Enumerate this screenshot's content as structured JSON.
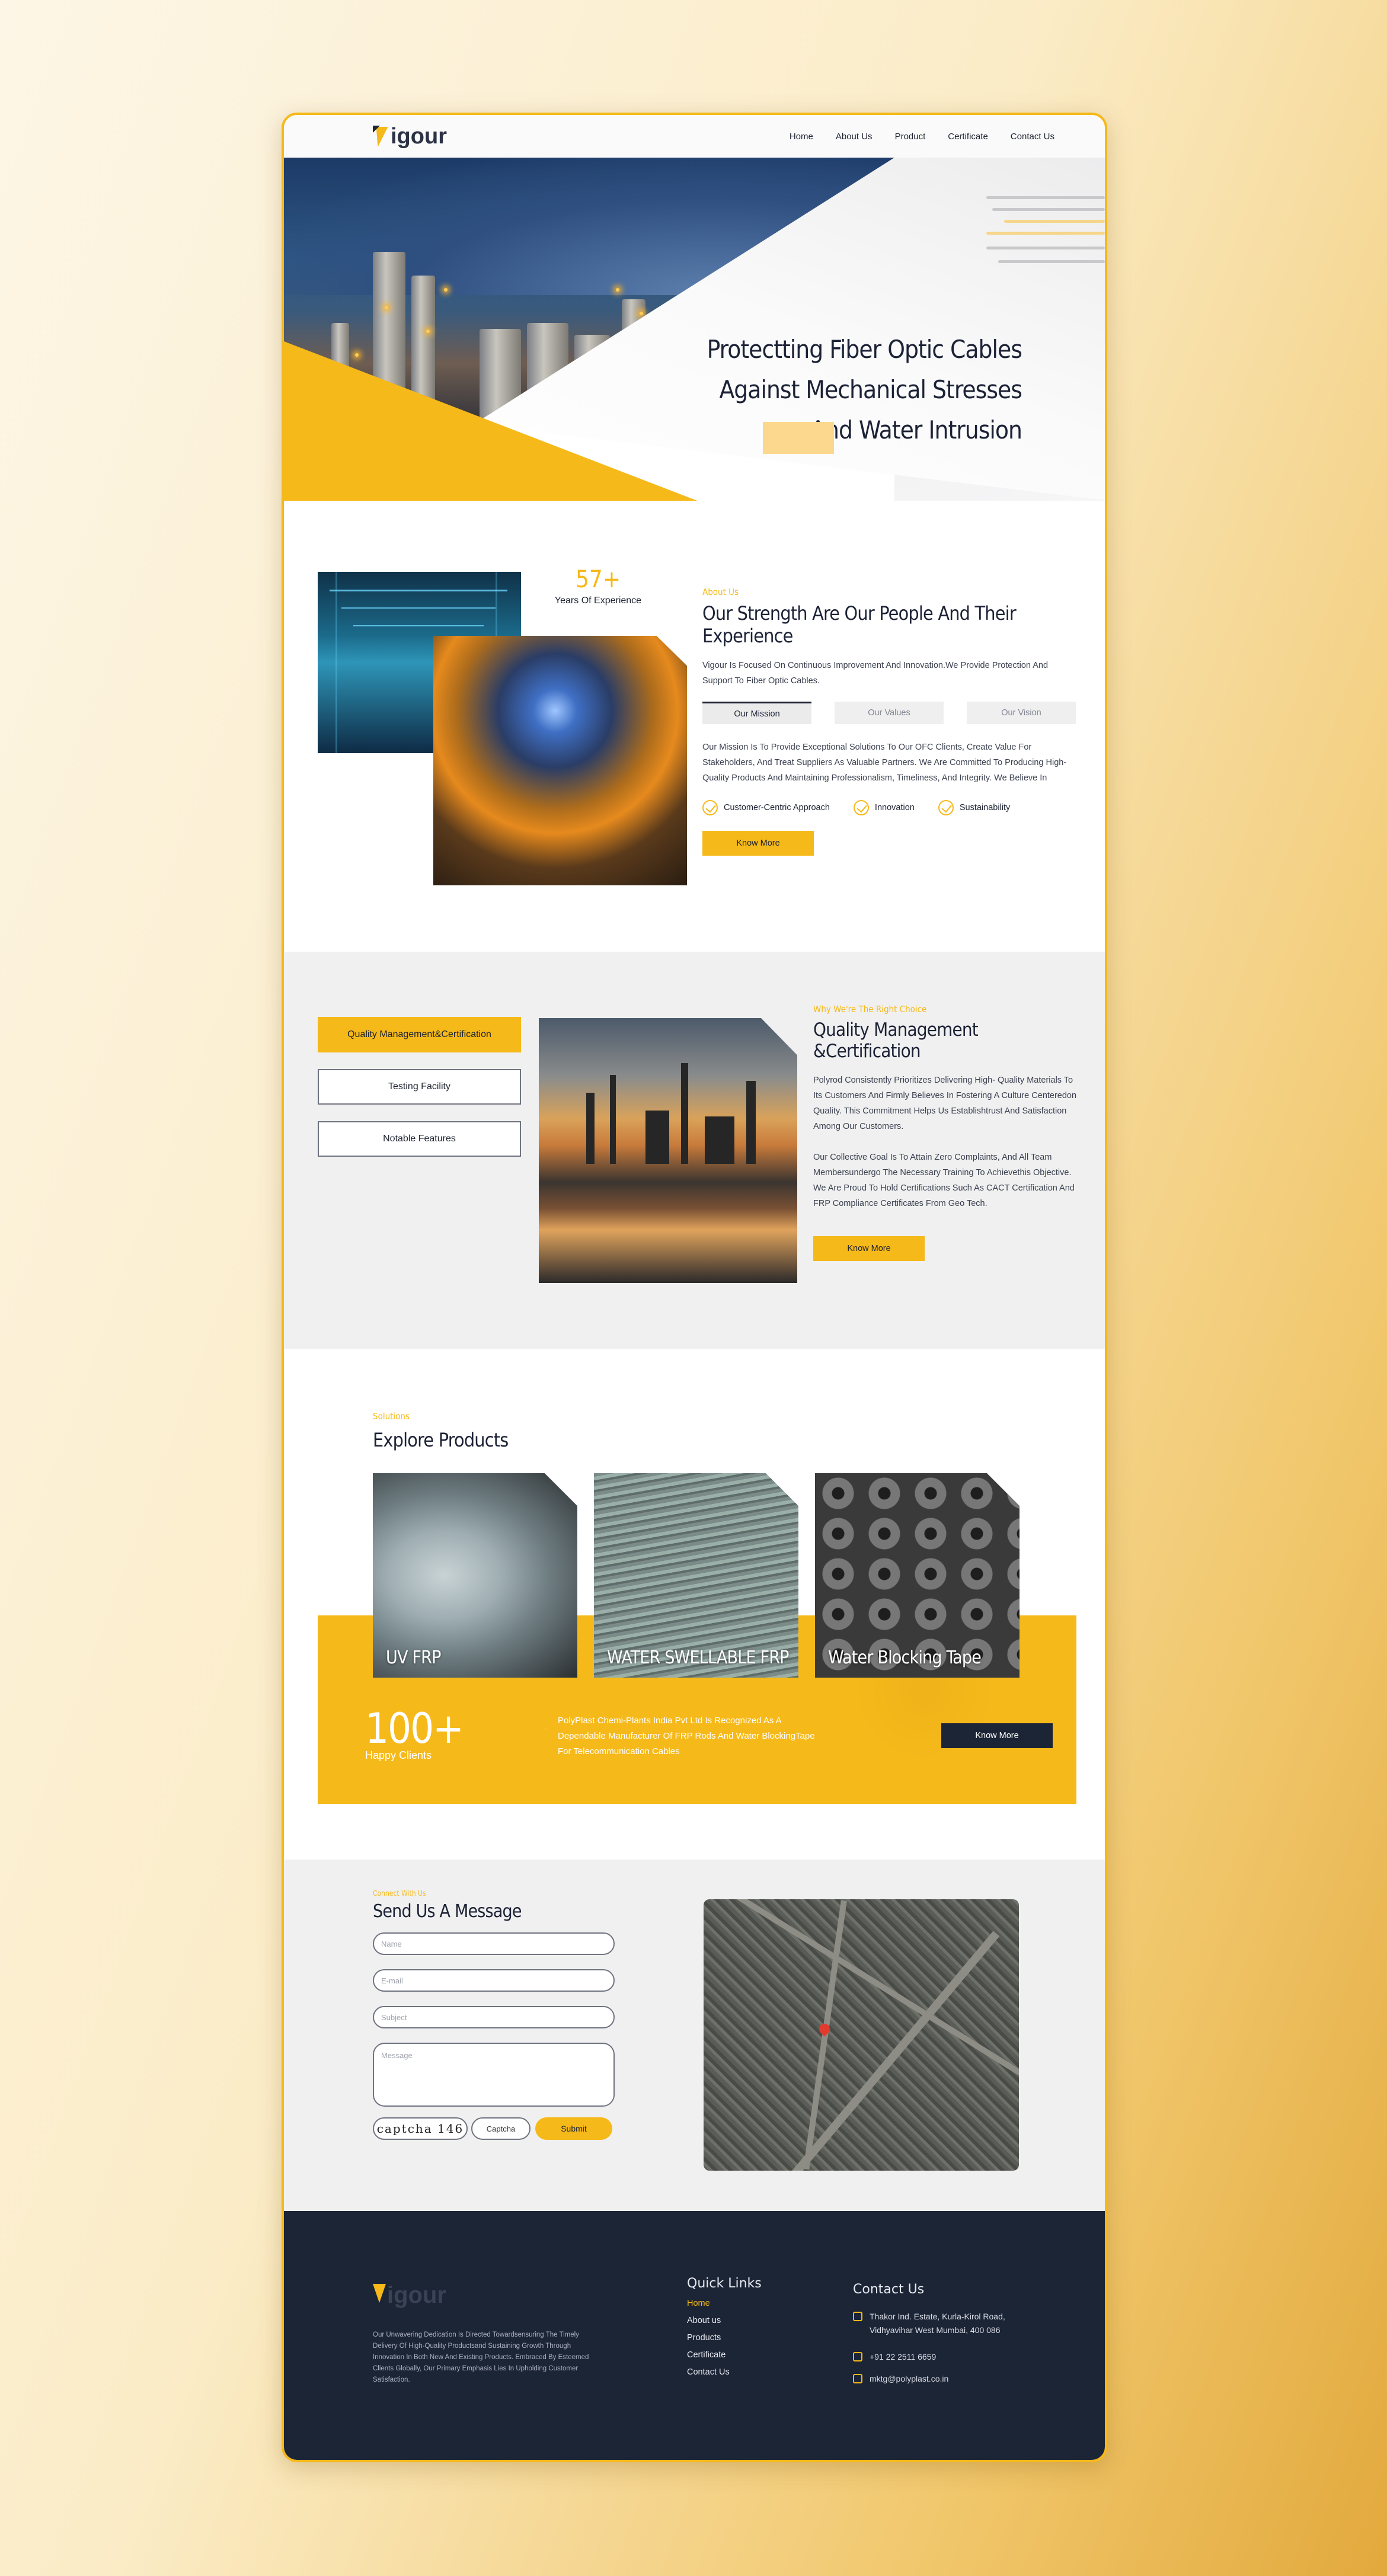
{
  "brand": {
    "name": "igour",
    "accent": "#f6b91a",
    "navy": "#1c2536"
  },
  "nav": [
    "Home",
    "About Us",
    "Product",
    "Certificate",
    "Contact  Us"
  ],
  "hero": {
    "line1": "Protectting Fiber Optic Cables",
    "line2": "Against  Mechanical Stresses",
    "line3": "And Water Intrusion"
  },
  "about": {
    "exp_number": "57+",
    "exp_label": "Years Of Experience",
    "tag": "About Us",
    "title": "Our Strength Are Our People And Their Experience",
    "text": "Vigour Is Focused On Continuous Improvement And Innovation.We Provide Protection And Support To Fiber Optic Cables.",
    "tabs": [
      "Our Mission",
      "Our Values",
      "Our Vision"
    ],
    "mission": "Our Mission Is To Provide Exceptional Solutions To Our OFC Clients, Create Value For Stakeholders, And Treat Suppliers As Valuable Partners. We Are Committed To Producing High-Quality Products And Maintaining Professionalism, Timeliness, And Integrity. We Believe In",
    "checks": [
      "Customer-Centric Approach",
      "Innovation",
      "Sustainability"
    ],
    "button": "Know More"
  },
  "quality": {
    "side_buttons": [
      "Quality Management&Certification",
      "Testing Facility",
      "Notable Features"
    ],
    "tag": "Why We're The Right Choice",
    "title": "Quality Management &Certification",
    "p1": "Polyrod Consistently Prioritizes Delivering High- Quality Materials To Its Customers And Firmly Believes In Fostering A Culture Centeredon Quality. This Commitment Helps Us Establishtrust And Satisfaction Among Our Customers.",
    "p2": "Our Collective Goal Is To Attain Zero Complaints, And All Team Membersundergo The Necessary Training To Achievethis Objective. We Are Proud To Hold Certifications Such As CACT Certification And FRP Compliance Certificates From Geo Tech.",
    "button": "Know More"
  },
  "products": {
    "tag": "Solutions",
    "title": "Explore Products",
    "items": [
      "UV FRP",
      "WATER SWELLABLE FRP",
      "Water Blocking Tape"
    ],
    "stat_number": "100+",
    "stat_label": "Happy Clients",
    "band_text": "PolyPlast Chemi-Plants India Pvt Ltd Is Recognized As A Dependable Manufacturer Of FRP Rods And Water BlockingTape For Telecommunication Cables",
    "button": "Know More"
  },
  "contact": {
    "tag": "Connect With Us",
    "title": "Send Us A Message",
    "name": "Name",
    "email": "E-mail",
    "subject": "Subject",
    "message": "Message",
    "captcha_image": "captcha 146",
    "captcha": "Captcha",
    "submit": "Submit"
  },
  "footer": {
    "description": "Our Unwavering Dedication Is Directed Towardsensuring The Timely Delivery Of High-Quality Productsand Sustaining Growth Through Innovation In Both New And Existing Products. Embraced By Esteemed Clients Globally, Our Primary Emphasis Lies In Upholding Customer Satisfaction.",
    "quick_links_title": "Quick Links",
    "links": [
      "Home",
      "About us",
      "Products",
      "Certificate",
      "Contact Us"
    ],
    "contact_title": "Contact Us",
    "address": "Thakor Ind. Estate, Kurla-Kirol Road, Vidhyavihar West Mumbai, 400 086",
    "phone": "+91 22 2511 6659",
    "email": "mktg@polyplast.co.in"
  }
}
